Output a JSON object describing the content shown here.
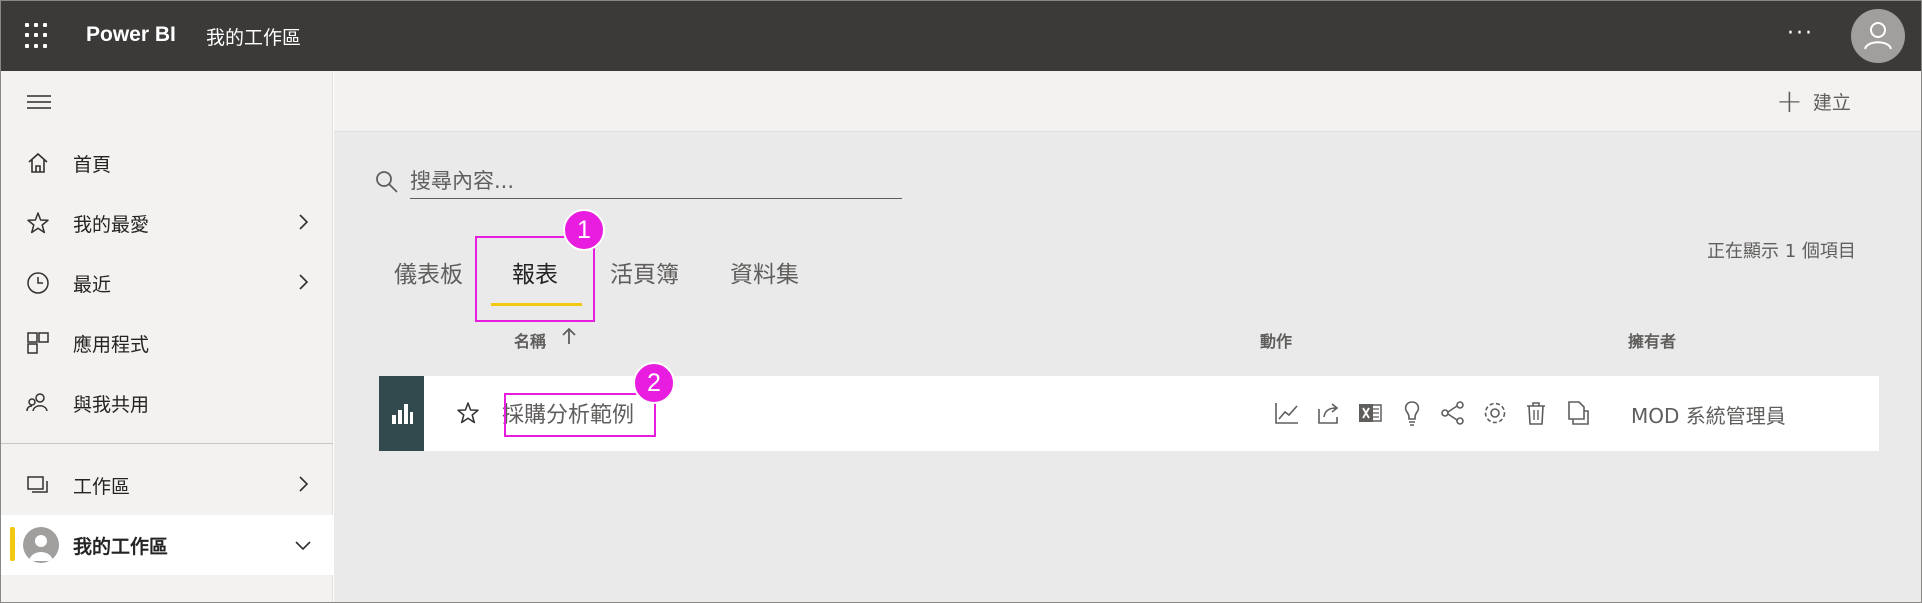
{
  "header": {
    "app_name": "Power BI",
    "workspace_title": "我的工作區",
    "more_label": "···"
  },
  "nav": {
    "items": [
      {
        "label": "首頁",
        "icon": "home-icon"
      },
      {
        "label": "我的最愛",
        "icon": "star-icon"
      },
      {
        "label": "最近",
        "icon": "clock-icon"
      },
      {
        "label": "應用程式",
        "icon": "apps-icon"
      },
      {
        "label": "與我共用",
        "icon": "shared-icon"
      }
    ],
    "workspaces_label": "工作區",
    "my_workspace_label": "我的工作區"
  },
  "commands": {
    "create_label": "建立",
    "create_icon": "plus-icon"
  },
  "search": {
    "placeholder": "搜尋內容..."
  },
  "tabs": [
    {
      "label": "儀表板",
      "active": false
    },
    {
      "label": "報表",
      "active": true
    },
    {
      "label": "活頁簿",
      "active": false
    },
    {
      "label": "資料集",
      "active": false
    }
  ],
  "item_count_text": "正在顯示 1 個項目",
  "columns": {
    "name": "名稱",
    "actions": "動作",
    "owner": "擁有者"
  },
  "rows": [
    {
      "name": "採購分析範例",
      "owner": "MOD 系統管理員",
      "actions": [
        "analytics-icon",
        "share-icon",
        "excel-icon",
        "insights-icon",
        "related-content-icon",
        "settings-icon",
        "delete-icon",
        "save-copy-icon"
      ]
    }
  ],
  "callouts": {
    "one": "1",
    "two": "2"
  },
  "colors": {
    "topbar": "#3b3a39",
    "accent_yellow": "#f2c811",
    "callout_magenta": "#e81de0",
    "report_tile": "#324a4e"
  }
}
